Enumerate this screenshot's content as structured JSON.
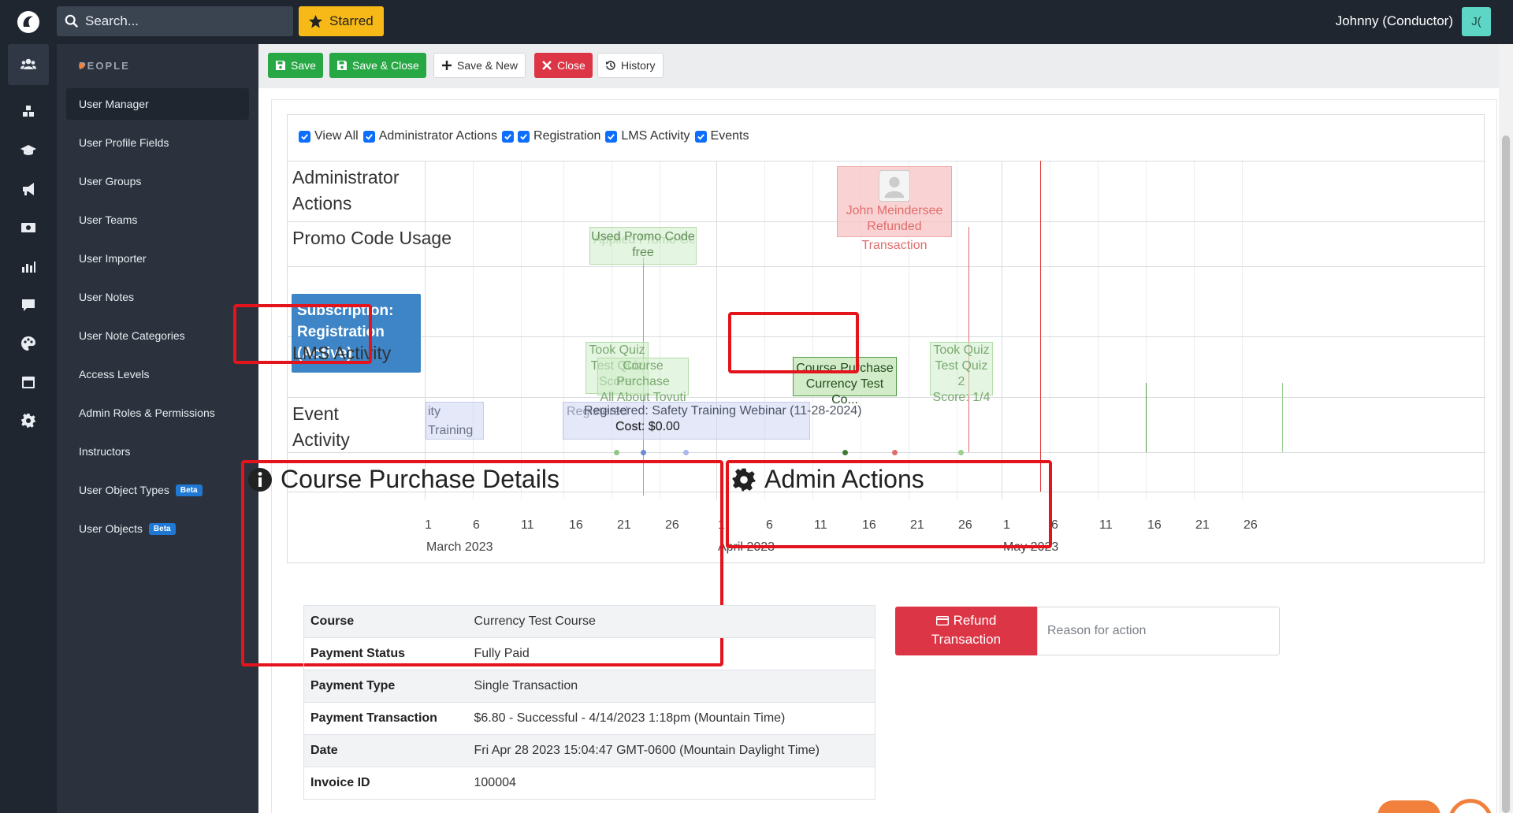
{
  "topbar": {
    "search_placeholder": "Search...",
    "starred_label": "Starred",
    "user_name": "Johnny (Conductor)",
    "avatar_initials": "J("
  },
  "rail": {
    "icons": [
      "users-icon",
      "cubes-icon",
      "graduation-cap-icon",
      "megaphone-icon",
      "money-icon",
      "chart-icon",
      "chat-icon",
      "palette-icon",
      "calendar-icon",
      "gear-icon"
    ]
  },
  "sidebar": {
    "section": "PEOPLE",
    "items": [
      {
        "label": "User Manager"
      },
      {
        "label": "User Profile Fields"
      },
      {
        "label": "User Groups"
      },
      {
        "label": "User Teams"
      },
      {
        "label": "User Importer"
      },
      {
        "label": "User Notes"
      },
      {
        "label": "User Note Categories"
      },
      {
        "label": "Access Levels"
      },
      {
        "label": "Admin Roles & Permissions"
      },
      {
        "label": "Instructors"
      },
      {
        "label": "User Object Types",
        "badge": "Beta"
      },
      {
        "label": "User Objects",
        "badge": "Beta"
      }
    ]
  },
  "toolbar": {
    "save": "Save",
    "save_close": "Save & Close",
    "save_new": "Save & New",
    "close": "Close",
    "history": "History"
  },
  "filters": [
    "View All",
    "Administrator Actions",
    "Registration",
    "LMS Activity",
    "Events"
  ],
  "timeline": {
    "rows": {
      "admin": "Administrator Actions",
      "promo": "Promo Code Usage",
      "subscription": "Subscription: Registration (Active)",
      "lms": "LMS Activity",
      "event": "Event Activity"
    },
    "events": {
      "admin_refund_line1": "John Meindersee",
      "admin_refund_line2": "Refunded Transaction",
      "promo_line1": "Used Promo Code",
      "promo_line2": "free",
      "promo_ghost": "Applied Promo Code",
      "quiz1_line1": "Took Quiz",
      "quiz1_line2": "Test Quiz",
      "quiz1_line3": "Score:",
      "cp_ghost_line1": "Course Purchase",
      "cp_ghost_line2": "All About Tovuti",
      "cp_main_line1": "Course Purchase",
      "cp_main_line2": "Currency Test Co...",
      "quiz2_line1": "Took Quiz",
      "quiz2_line2": "Test Quiz 2",
      "quiz2_line3": "Score: 1/4",
      "ev_training": "ity Training",
      "ev_reg_line1": "Registered: Safety Training Webinar (11-28-2024)",
      "ev_reg_ghost": "Registered",
      "ev_cost": "Cost: $0.00",
      "ev_cost_ghost": "Cost: $0."
    },
    "ticks": [
      "1",
      "6",
      "11",
      "16",
      "21",
      "26",
      "1",
      "6",
      "11",
      "16",
      "21",
      "26",
      "1",
      "6",
      "11",
      "16",
      "21",
      "26"
    ],
    "months": [
      "March 2023",
      "April 2023",
      "May 2023"
    ]
  },
  "details": {
    "title": "Course Purchase Details",
    "rows": [
      {
        "k": "Course",
        "v": "Currency Test Course"
      },
      {
        "k": "Payment Status",
        "v": "Fully Paid"
      },
      {
        "k": "Payment Type",
        "v": "Single Transaction"
      },
      {
        "k": "Payment Transaction",
        "v": "$6.80 - Successful - 4/14/2023 1:18pm (Mountain Time)"
      },
      {
        "k": "Date",
        "v": "Fri Apr 28 2023 15:04:47 GMT-0600 (Mountain Daylight Time)"
      },
      {
        "k": "Invoice ID",
        "v": "100004"
      }
    ]
  },
  "admin_actions": {
    "title": "Admin Actions",
    "refund_line1": "Refund",
    "refund_line2": "Transaction",
    "reason_placeholder": "Reason for action"
  },
  "colors": {
    "accent_green": "#28a745",
    "accent_red": "#dc3545",
    "highlight": "#e4141c",
    "subscription_blue": "#3d85c6"
  }
}
